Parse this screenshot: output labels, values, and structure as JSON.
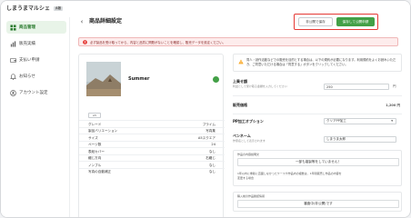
{
  "brand": {
    "name": "しまうまマルシェ",
    "badge": "β版"
  },
  "sidebar": {
    "items": [
      {
        "label": "商品管理",
        "icon": "grid-icon",
        "active": true
      },
      {
        "label": "販売実績",
        "icon": "chart-icon",
        "active": false
      },
      {
        "label": "支払い申請",
        "icon": "wallet-icon",
        "active": false
      },
      {
        "label": "お知らせ",
        "icon": "bell-icon",
        "active": false
      },
      {
        "label": "アカウント設定",
        "icon": "user-icon",
        "active": false
      }
    ]
  },
  "header": {
    "back_icon": "chevron-left-icon",
    "title": "商品詳細設定",
    "save_draft_label": "非公開で保存",
    "publish_label": "保存して公開申請"
  },
  "alert": {
    "text": "必ず製品を受け取ってから、内容と品質に問題がないことを確認し、販売データを設定ください。",
    "color": "#e53935"
  },
  "product": {
    "name": "Summer",
    "tag": "A5",
    "specs": [
      {
        "k": "グレード",
        "v": "プライム"
      },
      {
        "k": "製品バリエーション",
        "v": "写真集"
      },
      {
        "k": "サイズ",
        "v": "A5スクエア"
      },
      {
        "k": "ページ数",
        "v": "24"
      },
      {
        "k": "表紙カバー",
        "v": "なし"
      },
      {
        "k": "綴じ方向",
        "v": "右綴じ"
      },
      {
        "k": "ノンブル",
        "v": "なし"
      },
      {
        "k": "写真の自動補正",
        "v": "なし"
      }
    ]
  },
  "settings": {
    "info": "同人・創作活動などでの販売を目的とする場合は、以下の規約が必要になります。利用規約をよくお読みいただき、ご同意いただける場合は「同意する」ボタンをクリックしてください。",
    "price_label": "上乗せ額",
    "price_sub": "利益として受け取る金額を入力してください",
    "price_value": "250",
    "price_unit": "円",
    "sale_price_label": "販売価格",
    "sale_price_value": "1,200 円",
    "pp_label": "PP加工オプション",
    "pp_value": "クリアPP加工",
    "pen_label": "ペンネーム",
    "pen_sub": "作家名として表示されます",
    "pen_value": "しまうま太郎",
    "note1_title": "作品の内容説明文",
    "note1_value": "一部も複製等をしていません！",
    "note1_text1": "1年以内に重版に直面しなかったケースや作品内の複数は、1年間販売し作品の内容を",
    "note1_text2": "変更する場合",
    "note2_title": "購入前の作品確認情報",
    "note2_value": "審査中(非公開)です"
  },
  "colors": {
    "accent": "#43a047",
    "alert_border": "#e53935"
  }
}
